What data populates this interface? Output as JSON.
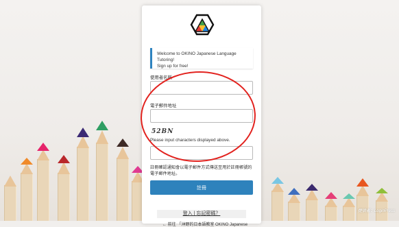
{
  "brand": {
    "logo_icon": "okino-hexagon-logo",
    "colors": [
      "#e53935",
      "#43a047",
      "#fbc02d",
      "#1e88e5"
    ]
  },
  "notice": {
    "line1": "Welcome to OKINO Japanese Language Tutoring!",
    "line2": "Sign up for free!"
  },
  "form": {
    "username_label": "使用者名稱",
    "email_label": "電子郵件地址",
    "captcha_text": "52BN",
    "captcha_hint": "Please input characters displayed above.",
    "registration_note": "註冊確認通知會以電子郵件方式傳送至用於註冊帳號的電子郵件地址。",
    "submit_label": "註冊"
  },
  "footer": {
    "links_text": "登入 | 忘記密碼？",
    "back_text": "← 前往 「沖野的日本語教室 OKINO Japanese"
  },
  "credit": "提供者：LoginPress",
  "accent_color": "#2e82bc",
  "annotation_color": "#e2221e"
}
